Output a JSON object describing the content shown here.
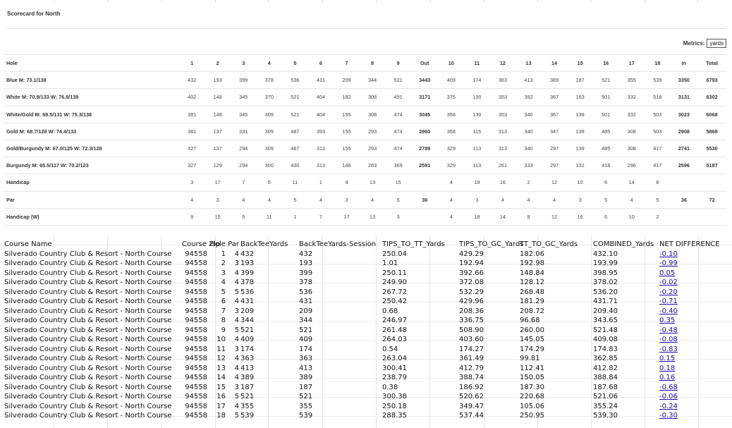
{
  "scorecard": {
    "title": "Scorecard for North",
    "metrics_label": "Metrics:",
    "metrics_value": "yards",
    "header": [
      "Hole",
      "1",
      "2",
      "3",
      "4",
      "5",
      "6",
      "7",
      "8",
      "9",
      "Out",
      "10",
      "11",
      "12",
      "13",
      "14",
      "15",
      "16",
      "17",
      "18",
      "In",
      "Total"
    ],
    "rows": [
      [
        "Blue M: 73.1/138",
        "432",
        "193",
        "399",
        "378",
        "536",
        "431",
        "209",
        "344",
        "521",
        "3443",
        "409",
        "174",
        "363",
        "413",
        "389",
        "187",
        "521",
        "355",
        "539",
        "3350",
        "6793"
      ],
      [
        "White M: 70.9/133 W: 76.8/139",
        "402",
        "148",
        "345",
        "370",
        "521",
        "404",
        "182",
        "308",
        "491",
        "3171",
        "375",
        "130",
        "353",
        "392",
        "367",
        "163",
        "501",
        "332",
        "518",
        "3131",
        "6302"
      ],
      [
        "White/Gold M: 69.5/131 W: 75.3/138",
        "381",
        "148",
        "345",
        "309",
        "521",
        "404",
        "155",
        "308",
        "474",
        "3045",
        "358",
        "130",
        "353",
        "340",
        "367",
        "139",
        "501",
        "332",
        "503",
        "3023",
        "6068"
      ],
      [
        "Gold M: 68.7/128 W: 74.4/133",
        "381",
        "137",
        "331",
        "309",
        "487",
        "393",
        "155",
        "293",
        "474",
        "2960",
        "358",
        "115",
        "313",
        "340",
        "347",
        "139",
        "485",
        "308",
        "503",
        "2908",
        "5868"
      ],
      [
        "Gold/Burgundy M: 67.0/125 W: 72.3/128",
        "327",
        "137",
        "294",
        "309",
        "487",
        "313",
        "155",
        "293",
        "474",
        "2789",
        "329",
        "113",
        "313",
        "340",
        "297",
        "139",
        "485",
        "308",
        "417",
        "2741",
        "5530"
      ],
      [
        "Burgundy M: 65.5/117 W: 70.2/123",
        "327",
        "129",
        "294",
        "300",
        "430",
        "313",
        "146",
        "283",
        "369",
        "2591",
        "329",
        "113",
        "261",
        "333",
        "297",
        "132",
        "418",
        "296",
        "417",
        "2596",
        "5187"
      ],
      [
        "Handicap",
        "3",
        "17",
        "7",
        "5",
        "11",
        "1",
        "9",
        "13",
        "15",
        "",
        "4",
        "18",
        "16",
        "2",
        "12",
        "10",
        "6",
        "14",
        "8",
        "",
        ""
      ],
      [
        "Par",
        "4",
        "3",
        "4",
        "4",
        "5",
        "4",
        "3",
        "4",
        "5",
        "36",
        "4",
        "3",
        "4",
        "4",
        "4",
        "3",
        "5",
        "4",
        "5",
        "36",
        "72"
      ],
      [
        "Handicap (W)",
        "9",
        "15",
        "5",
        "11",
        "1",
        "7",
        "17",
        "13",
        "3",
        "",
        "4",
        "18",
        "14",
        "8",
        "12",
        "16",
        "6",
        "10",
        "2",
        "",
        ""
      ]
    ]
  },
  "data_table": {
    "header": [
      "Course Name",
      "Course Zip",
      "Hole",
      "Par",
      "BackTeeYards",
      "BackTeeYards-Session",
      "TIPS_TO_TT_Yards",
      "TIPS_TO_GC_Yards",
      "TT_TO_GC_Yards",
      "COMBINED_Yards",
      "NET DIFFERENCE"
    ],
    "rows": [
      [
        "Silverado Country Club & Resort - North Course",
        "94558",
        "1",
        "4",
        "432",
        "432",
        "250.04",
        "429.29",
        "182.06",
        "432.10",
        "-0.10"
      ],
      [
        "Silverado Country Club & Resort - North Course",
        "94558",
        "2",
        "3",
        "193",
        "193",
        "1.01",
        "192.94",
        "192.98",
        "193.99",
        "-0.99"
      ],
      [
        "Silverado Country Club & Resort - North Course",
        "94558",
        "3",
        "4",
        "399",
        "399",
        "250.11",
        "392.66",
        "148.84",
        "398.95",
        "0.05"
      ],
      [
        "Silverado Country Club & Resort - North Course",
        "94558",
        "4",
        "4",
        "378",
        "378",
        "249.90",
        "372.08",
        "128.12",
        "378.02",
        "-0.02"
      ],
      [
        "Silverado Country Club & Resort - North Course",
        "94558",
        "5",
        "5",
        "536",
        "536",
        "267.72",
        "532.29",
        "268.48",
        "536.20",
        "-0.20"
      ],
      [
        "Silverado Country Club & Resort - North Course",
        "94558",
        "6",
        "4",
        "431",
        "431",
        "250.42",
        "429.96",
        "181.29",
        "431.71",
        "-0.71"
      ],
      [
        "Silverado Country Club & Resort - North Course",
        "94558",
        "7",
        "3",
        "209",
        "209",
        "0.68",
        "208.36",
        "208.72",
        "209.40",
        "-0.40"
      ],
      [
        "Silverado Country Club & Resort - North Course",
        "94558",
        "8",
        "4",
        "344",
        "344",
        "246.97",
        "336.75",
        "96.68",
        "343.65",
        "0.35"
      ],
      [
        "Silverado Country Club & Resort - North Course",
        "94558",
        "9",
        "5",
        "521",
        "521",
        "261.48",
        "508.90",
        "260.00",
        "521.48",
        "-0.48"
      ],
      [
        "Silverado Country Club & Resort - North Course",
        "94558",
        "10",
        "4",
        "409",
        "409",
        "264.03",
        "403.60",
        "145.05",
        "409.08",
        "-0.08"
      ],
      [
        "Silverado Country Club & Resort - North Course",
        "94558",
        "11",
        "3",
        "174",
        "174",
        "0.54",
        "174.27",
        "174.29",
        "174.83",
        "-0.83"
      ],
      [
        "Silverado Country Club & Resort - North Course",
        "94558",
        "12",
        "4",
        "363",
        "363",
        "263.04",
        "361.49",
        "99.81",
        "362.85",
        "0.15"
      ],
      [
        "Silverado Country Club & Resort - North Course",
        "94558",
        "13",
        "4",
        "413",
        "413",
        "300.41",
        "412.79",
        "112.41",
        "412.82",
        "0.18"
      ],
      [
        "Silverado Country Club & Resort - North Course",
        "94558",
        "14",
        "4",
        "389",
        "389",
        "238.79",
        "388.74",
        "150.05",
        "388.84",
        "0.16"
      ],
      [
        "Silverado Country Club & Resort - North Course",
        "94558",
        "15",
        "3",
        "187",
        "187",
        "0.38",
        "186.92",
        "187.30",
        "187.68",
        "-0.68"
      ],
      [
        "Silverado Country Club & Resort - North Course",
        "94558",
        "16",
        "5",
        "521",
        "521",
        "300.38",
        "520.62",
        "220.68",
        "521.06",
        "-0.06"
      ],
      [
        "Silverado Country Club & Resort - North Course",
        "94558",
        "17",
        "4",
        "355",
        "355",
        "250.18",
        "349.47",
        "105.06",
        "355.24",
        "-0.24"
      ],
      [
        "Silverado Country Club & Resort - North Course",
        "94558",
        "18",
        "5",
        "539",
        "539",
        "288.35",
        "537.44",
        "250.95",
        "539.30",
        "-0.30"
      ]
    ]
  }
}
